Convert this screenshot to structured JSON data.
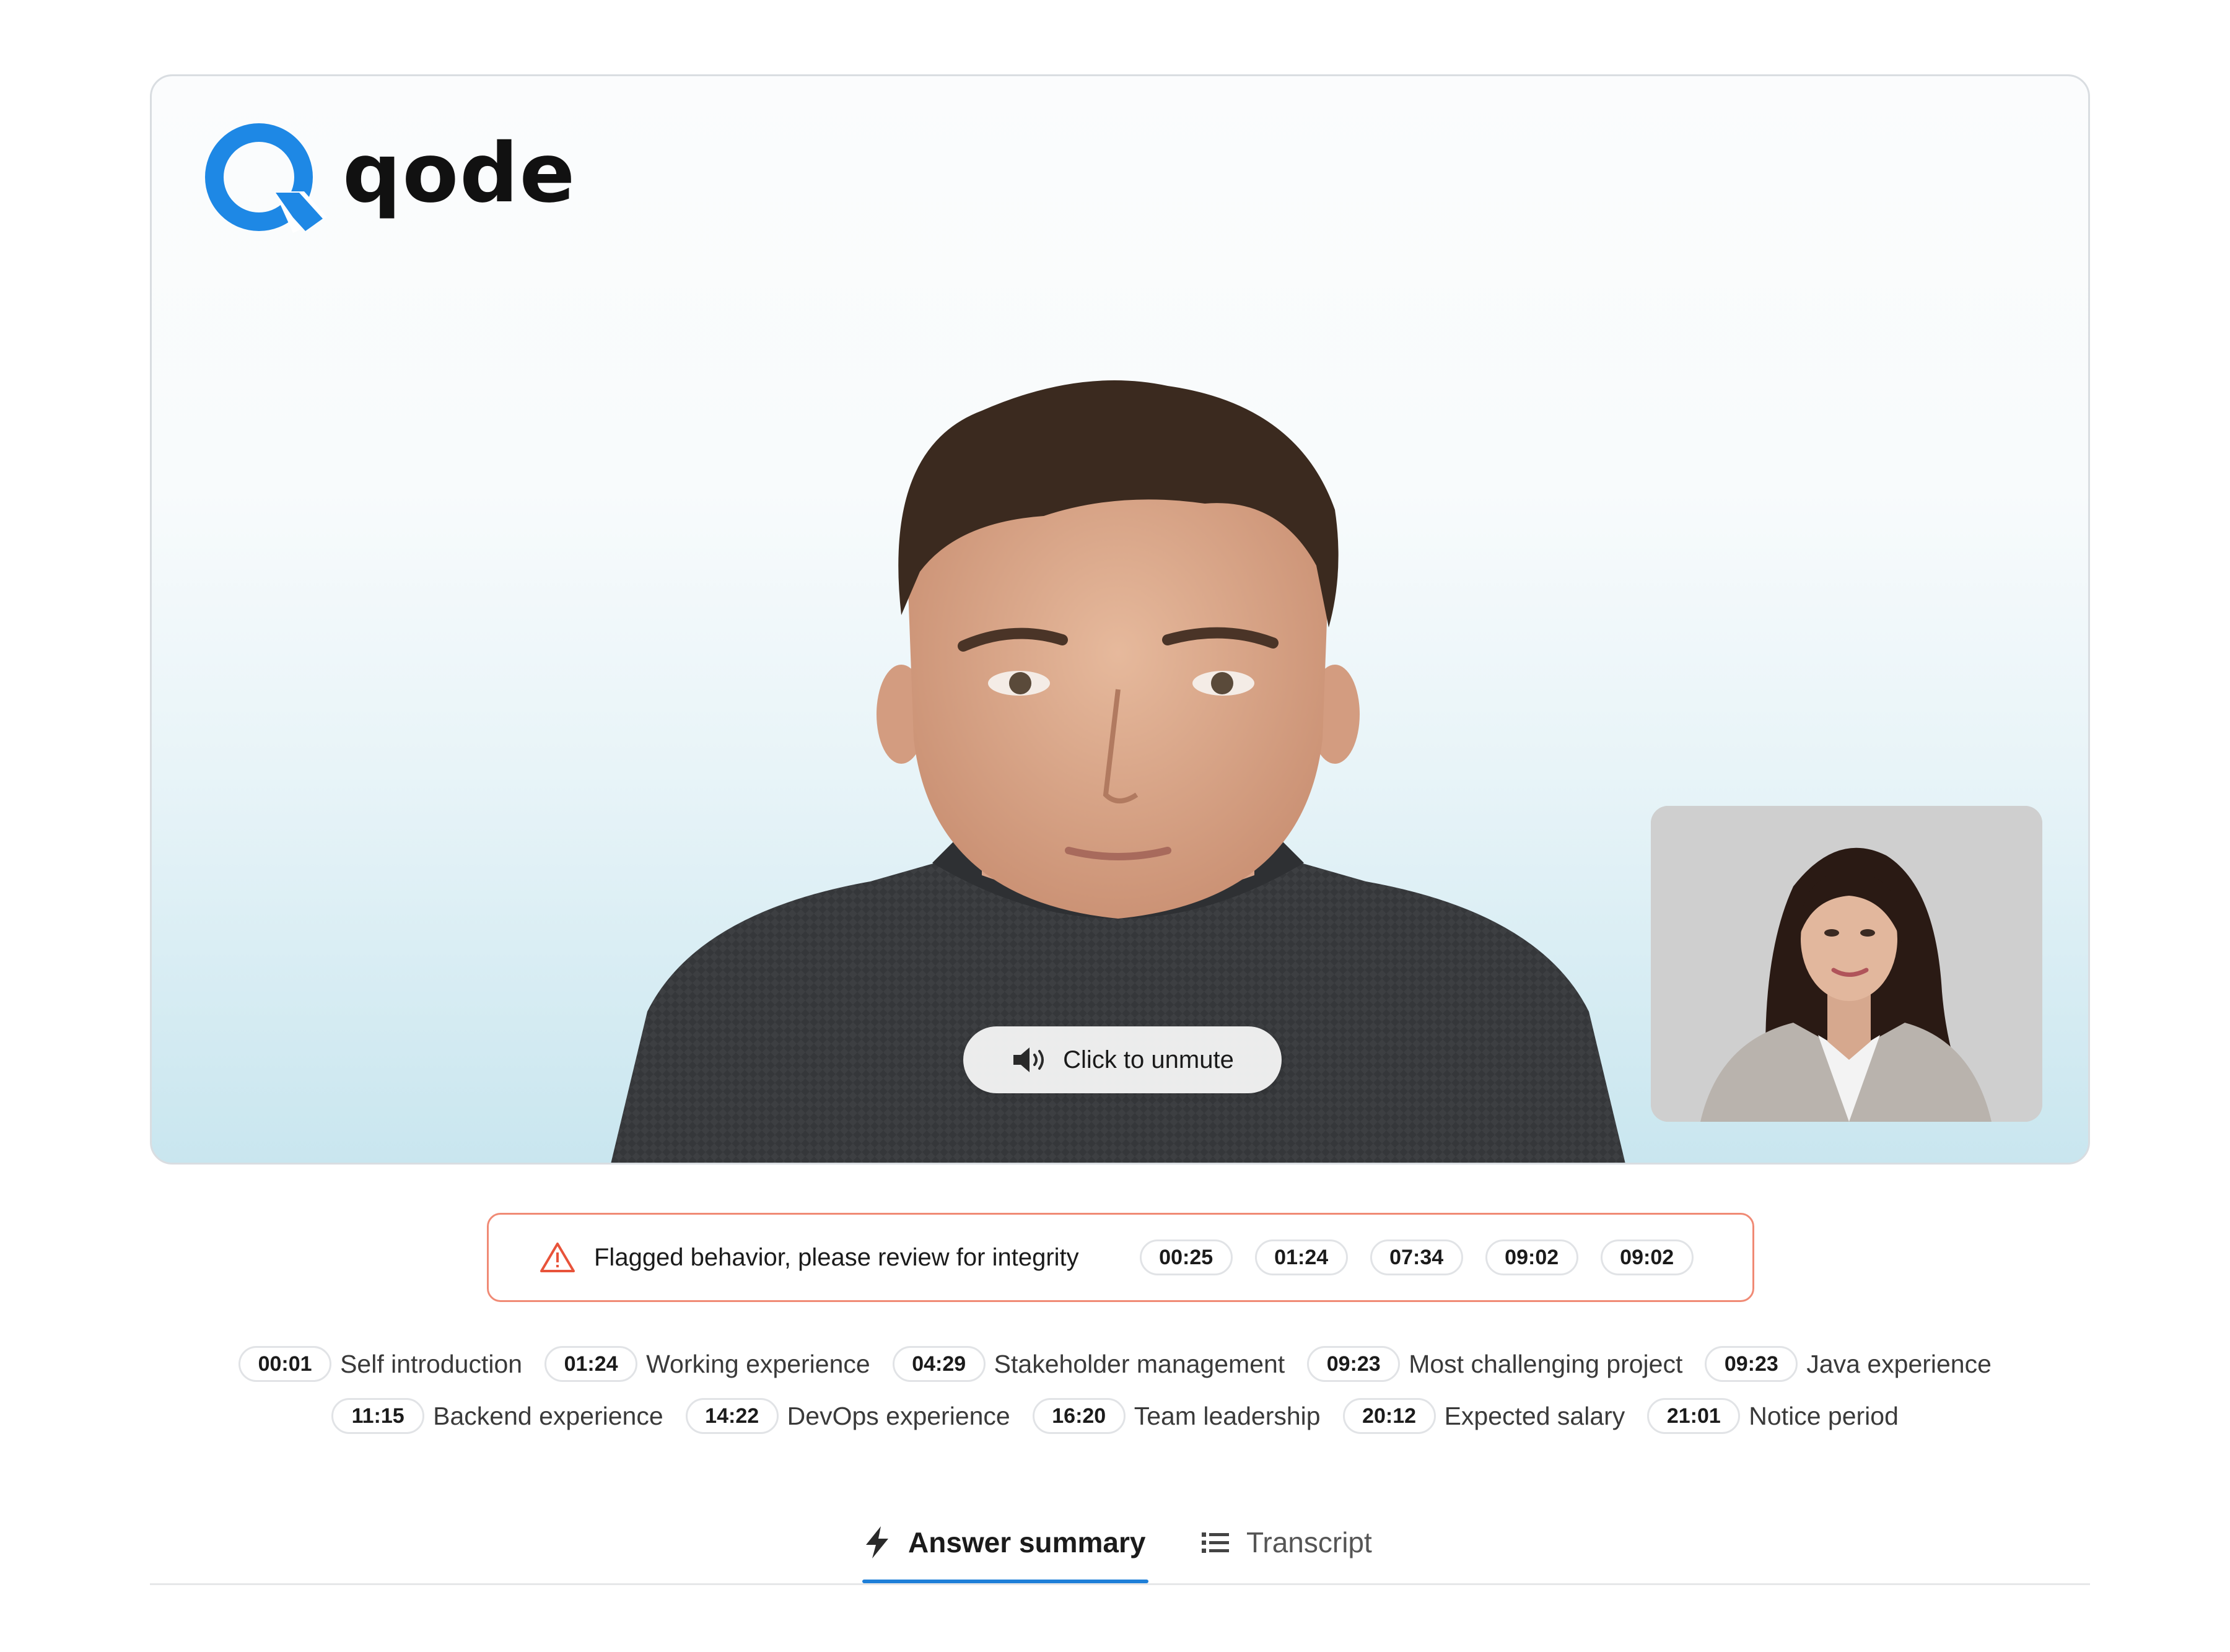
{
  "brand": {
    "name": "qode",
    "accent": "#1E88E5",
    "logo_icon": "q-logo-icon"
  },
  "video": {
    "unmute_label": "Click to unmute",
    "unmute_icon": "speaker-muted-icon",
    "candidate_feed": "candidate-video",
    "interviewer_feed": "interviewer-pip-video"
  },
  "flags": {
    "icon": "warning-triangle-icon",
    "message": "Flagged behavior, please review for integrity",
    "color": "#F08A75",
    "times": [
      "00:25",
      "01:24",
      "07:34",
      "09:02",
      "09:02"
    ]
  },
  "chapters": {
    "row1": [
      {
        "time": "00:01",
        "label": "Self introduction"
      },
      {
        "time": "01:24",
        "label": "Working experience"
      },
      {
        "time": "04:29",
        "label": "Stakeholder management"
      },
      {
        "time": "09:23",
        "label": "Most challenging project"
      },
      {
        "time": "09:23",
        "label": "Java experience"
      }
    ],
    "row2": [
      {
        "time": "11:15",
        "label": "Backend experience"
      },
      {
        "time": "14:22",
        "label": "DevOps experience"
      },
      {
        "time": "16:20",
        "label": "Team leadership"
      },
      {
        "time": "20:12",
        "label": "Expected salary"
      },
      {
        "time": "21:01",
        "label": "Notice period"
      }
    ]
  },
  "tabs": {
    "answer_summary": {
      "label": "Answer summary",
      "icon": "lightning-icon",
      "active": true
    },
    "transcript": {
      "label": "Transcript",
      "icon": "list-icon",
      "active": false
    },
    "active_color": "#1E7FD8"
  }
}
